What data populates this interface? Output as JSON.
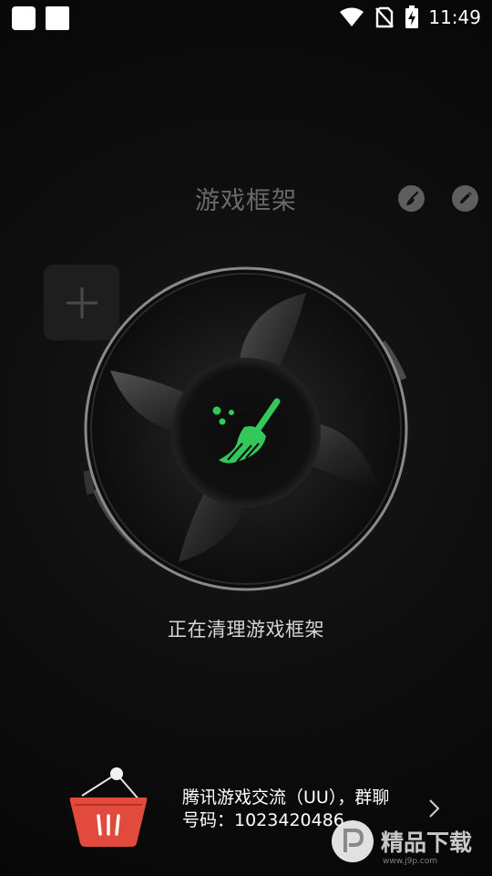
{
  "status_bar": {
    "time": "11:49",
    "icons": [
      "wifi-icon",
      "no-sim-icon",
      "battery-charging-icon"
    ]
  },
  "header": {
    "title": "游戏框架",
    "actions": [
      "broom-icon",
      "pencil-icon"
    ]
  },
  "add_tile": {
    "icon": "plus-icon"
  },
  "cleaner": {
    "icon": "broom-icon",
    "status_text": "正在清理游戏框架",
    "accent_color": "#34c75a"
  },
  "promo": {
    "icon": "basket-icon",
    "line1": "腾讯游戏交流（UU），群聊",
    "line2": "号码：1023420486",
    "accent_color": "#e14a3c"
  },
  "watermark": {
    "brand_text": "精品下载",
    "url_text": "www.j9p.com"
  }
}
